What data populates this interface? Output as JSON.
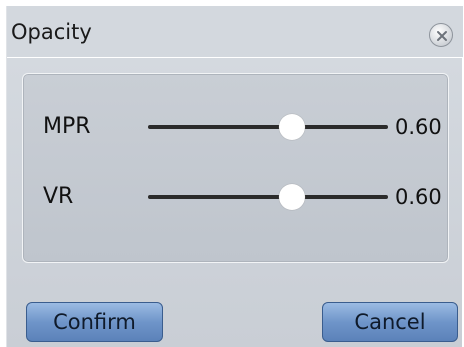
{
  "dialog": {
    "title": "Opacity",
    "close_icon": "close-icon"
  },
  "sliders": [
    {
      "label": "MPR",
      "value": 0.6,
      "value_text": "0.60"
    },
    {
      "label": "VR",
      "value": 0.6,
      "value_text": "0.60"
    }
  ],
  "buttons": {
    "confirm_label": "Confirm",
    "cancel_label": "Cancel"
  },
  "colors": {
    "button_accent": "#6f95c9",
    "track": "#2b2b2b"
  }
}
